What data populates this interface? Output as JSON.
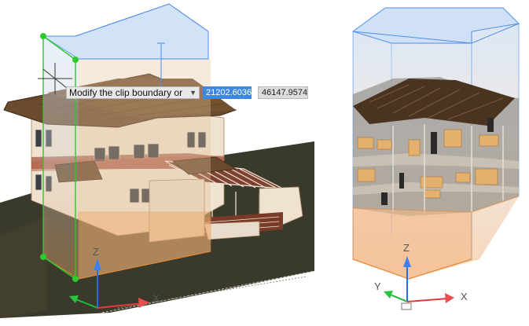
{
  "prompt": {
    "text": "Modify the clip boundary or",
    "x_value": "21202.6036",
    "y_value": "46147.9574"
  },
  "axes": {
    "x": "X",
    "y": "Y",
    "z": "Z"
  },
  "colors": {
    "clip_box_blue": "#c9dcf5",
    "clip_box_orange": "#f2c79c",
    "grip_green": "#2dc92d",
    "ground": "#3a3a2c",
    "roof": "#6b4a2e",
    "wall": "#eee0cf",
    "input_active": "#3c88e0"
  }
}
